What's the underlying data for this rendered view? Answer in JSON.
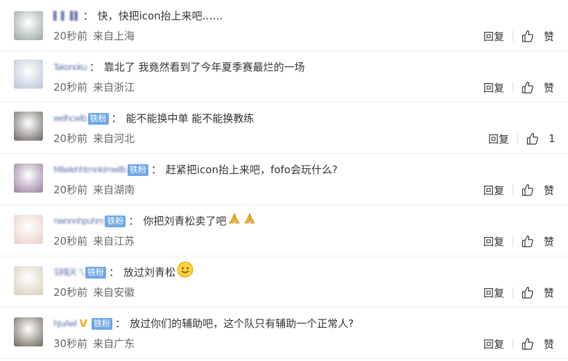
{
  "comments": [
    {
      "username": "▌ ▌▐ ▌",
      "badge": "",
      "vip": false,
      "text": "快，快把icon抬上来吧……",
      "emojis": [],
      "time": "20秒前",
      "location": "来自上海",
      "reply_label": "回复",
      "like_label": "赞",
      "avatar_color": "#9aa7a0"
    },
    {
      "username": "Takonoku",
      "badge": "",
      "vip": false,
      "text": "靠北了 我竟然看到了今年夏季赛最烂的一场",
      "emojis": [],
      "time": "20秒前",
      "location": "来自浙江",
      "reply_label": "回复",
      "like_label": "赞",
      "avatar_color": "#b9c3d6"
    },
    {
      "username": "welhcwlb",
      "badge": "铁粉",
      "vip": false,
      "text": "能不能换中单 能不能换教练",
      "emojis": [],
      "time": "20秒前",
      "location": "来自河北",
      "reply_label": "回复",
      "like_label": "1",
      "avatar_color": "#6b6560"
    },
    {
      "username": "Milwlehhtmnkimwllb",
      "badge": "铁粉",
      "vip": false,
      "text": "赶紧把icon抬上来吧，fofo会玩什么?",
      "emojis": [],
      "time": "20秒前",
      "location": "来自湖南",
      "reply_label": "回复",
      "like_label": "赞",
      "avatar_color": "#9a7ea0"
    },
    {
      "username": "nwnnnhpuhm",
      "badge": "铁粉",
      "vip": false,
      "text": "你把刘青松卖了吧",
      "emojis": [
        "pray-emoji",
        "pray-emoji"
      ],
      "time": "20秒前",
      "location": "来自江苏",
      "reply_label": "回复",
      "like_label": "赞",
      "avatar_color": "#e8cfc4"
    },
    {
      "username": "羽嘎天乁",
      "badge": "铁粉",
      "vip": false,
      "text": "放过刘青松",
      "emojis": [
        "smile-emoji"
      ],
      "time": "20秒前",
      "location": "来自安徽",
      "reply_label": "回复",
      "like_label": "赞",
      "avatar_color": "#d9cdb8"
    },
    {
      "username": "hjuAwl",
      "badge": "铁粉",
      "vip": true,
      "text": "放过你们的辅助吧，这个队只有辅助一个正常人?",
      "emojis": [],
      "time": "30秒前",
      "location": "来自广东",
      "reply_label": "回复",
      "like_label": "赞",
      "avatar_color": "#6e6559"
    }
  ],
  "colors": {
    "username": "#5b6fa8",
    "badge": "#6fa8e6",
    "vip": "#f5a623"
  }
}
